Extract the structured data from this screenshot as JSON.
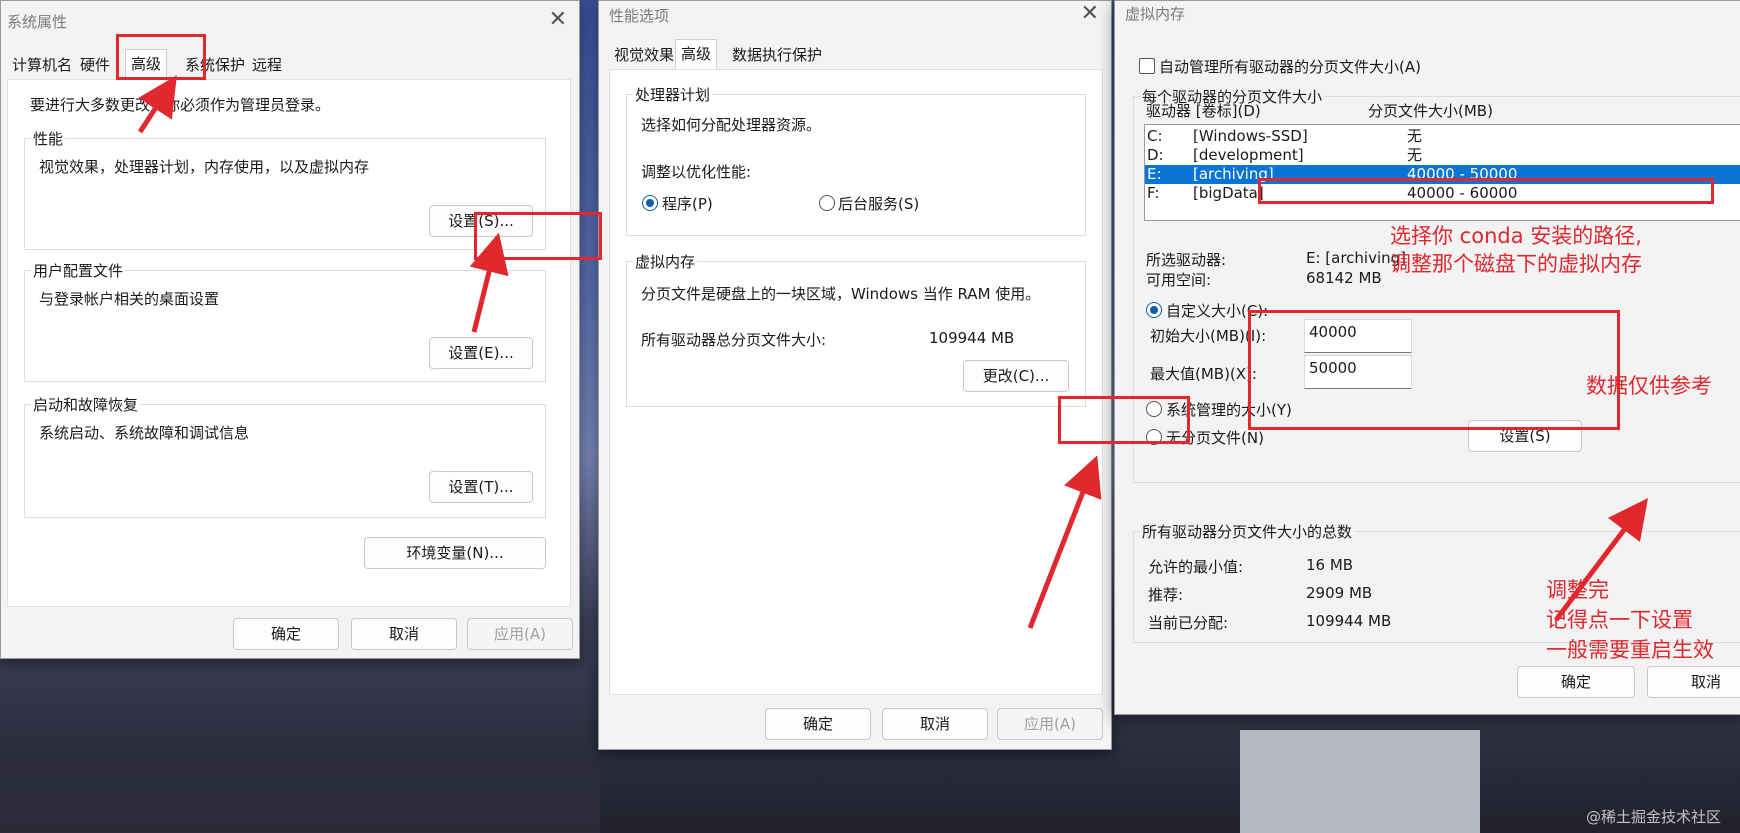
{
  "sysprops": {
    "title": "系统属性",
    "tabs": [
      "计算机名",
      "硬件",
      "高级",
      "系统保护",
      "远程"
    ],
    "admin_note": "要进行大多数更改，你必须作为管理员登录。",
    "performance": {
      "label": "性能",
      "desc": "视觉效果，处理器计划，内存使用，以及虚拟内存",
      "button": "设置(S)..."
    },
    "user_profiles": {
      "label": "用户配置文件",
      "desc": "与登录帐户相关的桌面设置",
      "button": "设置(E)..."
    },
    "startup": {
      "label": "启动和故障恢复",
      "desc": "系统启动、系统故障和调试信息",
      "button": "设置(T)..."
    },
    "env_button": "环境变量(N)...",
    "ok": "确定",
    "cancel": "取消",
    "apply": "应用(A)"
  },
  "perfopts": {
    "title": "性能选项",
    "tabs": [
      "视觉效果",
      "高级",
      "数据执行保护"
    ],
    "processor": {
      "label": "处理器计划",
      "desc": "选择如何分配处理器资源。",
      "adjust": "调整以优化性能:",
      "opt_programs": "程序(P)",
      "opt_services": "后台服务(S)"
    },
    "vmem": {
      "label": "虚拟内存",
      "desc": "分页文件是硬盘上的一块区域，Windows 当作 RAM 使用。",
      "total_label": "所有驱动器总分页文件大小:",
      "total_value": "109944 MB",
      "change_button": "更改(C)..."
    },
    "ok": "确定",
    "cancel": "取消",
    "apply": "应用(A)"
  },
  "virtmem": {
    "title": "虚拟内存",
    "auto_manage": "自动管理所有驱动器的分页文件大小(A)",
    "per_drive_label": "每个驱动器的分页文件大小",
    "col_drive": "驱动器 [卷标](D)",
    "col_size": "分页文件大小(MB)",
    "drives": [
      {
        "letter": "C:",
        "label": "[Windows-SSD]",
        "size": "无"
      },
      {
        "letter": "D:",
        "label": "[development]",
        "size": "无"
      },
      {
        "letter": "E:",
        "label": "[archiving]",
        "size": "40000 - 50000"
      },
      {
        "letter": "F:",
        "label": "[bigData]",
        "size": "40000 - 60000"
      }
    ],
    "selected_drive_label": "所选驱动器:",
    "selected_drive_value": "E:  [archiving]",
    "free_space_label": "可用空间:",
    "free_space_value": "68142 MB",
    "custom_size": "自定义大小(C):",
    "initial_label": "初始大小(MB)(I):",
    "initial_value": "40000",
    "max_label": "最大值(MB)(X):",
    "max_value": "50000",
    "system_managed": "系统管理的大小(Y)",
    "no_paging": "无分页文件(N)",
    "set_button": "设置(S)",
    "totals_label": "所有驱动器分页文件大小的总数",
    "min_label": "允许的最小值:",
    "min_value": "16 MB",
    "rec_label": "推荐:",
    "rec_value": "2909 MB",
    "cur_label": "当前已分配:",
    "cur_value": "109944 MB",
    "ok": "确定",
    "cancel": "取消"
  },
  "annotations": {
    "select_path_1": "选择你 conda 安装的路径,",
    "select_path_2": "调整那个磁盘下的虚拟内存",
    "data_ref": "数据仅供参考",
    "after_1": "调整完",
    "after_2": "记得点一下设置",
    "after_3": "一般需要重启生效",
    "color": "#e0282e"
  },
  "watermark": "@稀土掘金技术社区"
}
